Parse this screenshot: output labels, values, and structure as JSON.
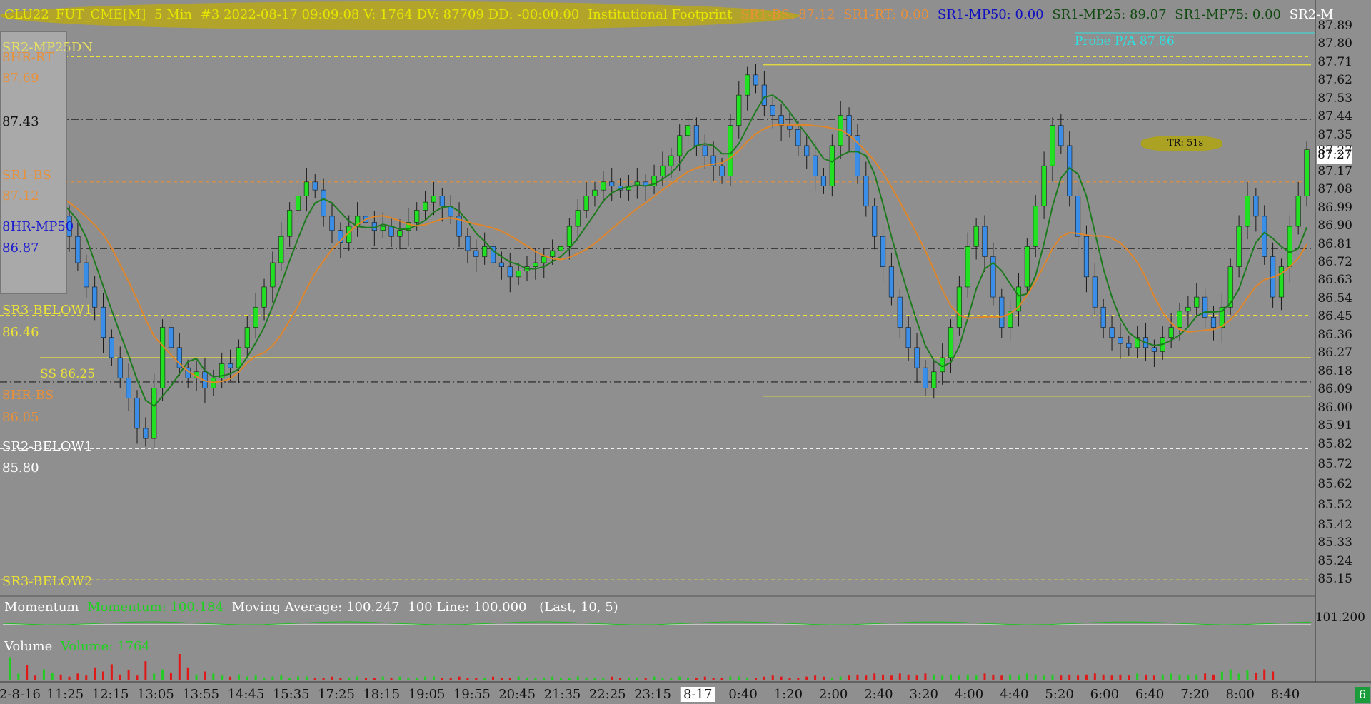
{
  "header": {
    "symbol": "CLU22_FUT_CME[M]",
    "interval": "5 Min",
    "bar_info": "#3 2022-08-17 09:09:08 V: 1764 DV: 87709 DD: -00:00:00",
    "study": "Institutional Footprint",
    "sr1_bs": "SR1-BS: 87.12",
    "sr1_rt": "SR1-RT: 0.00",
    "sr1_mp50": "SR1-MP50: 0.00",
    "sr1_mp25": "SR1-MP25: 89.07",
    "sr1_mp75": "SR1-MP75: 0.00",
    "sr2_m": "SR2-M"
  },
  "annotations": {
    "probe": "Probe P/A 87.86",
    "tr": "TR: 51s",
    "ss": "SS 86.25",
    "price_box_label": "87.43"
  },
  "levels": [
    {
      "label": "SR2-MP25DN",
      "value": "",
      "color": "#e8e060"
    },
    {
      "label": "8HR-RT",
      "value": "87.69",
      "color": "#e8903a"
    },
    {
      "label": "SR1-BS",
      "value": "87.12",
      "color": "#e8903a"
    },
    {
      "label": "8HR-MP50",
      "value": "86.87",
      "color": "#1a1ad0"
    },
    {
      "label": "SR3-BELOW1",
      "value": "86.46",
      "color": "#ece238"
    },
    {
      "label": "8HR-BS",
      "value": "86.05",
      "color": "#e8903a"
    },
    {
      "label": "SR2-BELOW1",
      "value": "85.80",
      "color": "#ffffff"
    },
    {
      "label": "SR3-BELOW2",
      "value": "",
      "color": "#ece238"
    }
  ],
  "momentum": {
    "title": "Momentum",
    "value": "Momentum: 100.184",
    "ma": "Moving Average: 100.247",
    "line": "100 Line: 100.000",
    "params": "(Last, 10, 5)",
    "axis_label": "101.200"
  },
  "volume": {
    "title": "Volume",
    "value": "Volume: 1764"
  },
  "corner_badge": "6",
  "colors": {
    "background": "#8f8f8f",
    "up_candle": "#22e022",
    "down_candle": "#3a8ee8",
    "ma_fast": "#1e7a1e",
    "ma_slow": "#e0862a",
    "header_yellow": "#e6e600",
    "volume_up": "#22cc22",
    "volume_down": "#e01818"
  },
  "chart_data": {
    "type": "candlestick",
    "y_ticks": [
      "87.89",
      "87.80",
      "87.71",
      "87.62",
      "87.53",
      "87.44",
      "87.35",
      "87.27",
      "87.17",
      "87.08",
      "86.99",
      "86.90",
      "86.81",
      "86.72",
      "86.63",
      "86.54",
      "86.45",
      "86.36",
      "86.27",
      "86.18",
      "86.09",
      "86.00",
      "85.91",
      "85.82",
      "85.72",
      "85.62",
      "85.52",
      "85.42",
      "85.33",
      "85.24",
      "85.15"
    ],
    "last_price": "87.27",
    "ylim": [
      85.08,
      87.95
    ],
    "x_ticks": [
      "2-8-16",
      "11:25",
      "12:15",
      "13:05",
      "13:55",
      "14:45",
      "15:35",
      "17:25",
      "18:15",
      "19:05",
      "19:55",
      "20:45",
      "21:35",
      "22:25",
      "23:15",
      "8-17",
      "0:40",
      "1:20",
      "2:00",
      "2:40",
      "3:20",
      "4:00",
      "4:40",
      "5:20",
      "6:00",
      "6:40",
      "7:20",
      "8:00",
      "8:40"
    ],
    "horizontal_levels": [
      {
        "price": 87.74,
        "style": "dashed",
        "color": "#ece238"
      },
      {
        "price": 87.43,
        "style": "dashdot",
        "color": "#222222"
      },
      {
        "price": 87.12,
        "style": "dashed",
        "color": "#e8903a"
      },
      {
        "price": 86.79,
        "style": "dashdot",
        "color": "#222222"
      },
      {
        "price": 86.46,
        "style": "dashed",
        "color": "#ece238"
      },
      {
        "price": 86.25,
        "style": "solid",
        "color": "#ece238"
      },
      {
        "price": 86.13,
        "style": "dashdot",
        "color": "#222222"
      },
      {
        "price": 85.8,
        "style": "dashed",
        "color": "#ffffff"
      },
      {
        "price": 85.15,
        "style": "dashed",
        "color": "#ece238"
      }
    ],
    "tr_high": 87.7,
    "tr_low": 86.06,
    "closes": [
      87.05,
      87.15,
      87.05,
      86.98,
      87.02,
      87.1,
      86.95,
      86.85,
      86.72,
      86.6,
      86.5,
      86.35,
      86.25,
      86.15,
      86.05,
      85.9,
      85.85,
      86.1,
      86.4,
      86.3,
      86.2,
      86.15,
      86.18,
      86.1,
      86.15,
      86.22,
      86.2,
      86.3,
      86.4,
      86.5,
      86.6,
      86.72,
      86.85,
      86.98,
      87.05,
      87.12,
      87.08,
      86.95,
      86.88,
      86.82,
      86.9,
      86.95,
      86.92,
      86.88,
      86.9,
      86.85,
      86.88,
      86.92,
      86.98,
      87.02,
      87.05,
      87.0,
      86.95,
      86.85,
      86.78,
      86.75,
      86.8,
      86.72,
      86.7,
      86.65,
      86.68,
      86.7,
      86.72,
      86.75,
      86.78,
      86.8,
      86.9,
      86.98,
      87.05,
      87.08,
      87.12,
      87.1,
      87.08,
      87.1,
      87.12,
      87.1,
      87.15,
      87.2,
      87.25,
      87.35,
      87.4,
      87.3,
      87.25,
      87.2,
      87.15,
      87.4,
      87.55,
      87.65,
      87.6,
      87.5,
      87.45,
      87.4,
      87.38,
      87.3,
      87.25,
      87.15,
      87.1,
      87.3,
      87.45,
      87.35,
      87.15,
      87.0,
      86.85,
      86.7,
      86.55,
      86.4,
      86.3,
      86.2,
      86.1,
      86.18,
      86.25,
      86.4,
      86.6,
      86.8,
      86.9,
      86.75,
      86.55,
      86.4,
      86.48,
      86.6,
      86.8,
      87.0,
      87.2,
      87.4,
      87.3,
      87.05,
      86.85,
      86.65,
      86.5,
      86.4,
      86.35,
      86.32,
      86.3,
      86.35,
      86.3,
      86.28,
      86.35,
      86.4,
      86.48,
      86.5,
      86.55,
      86.45,
      86.4,
      86.5,
      86.7,
      86.9,
      87.05,
      86.95,
      86.75,
      86.55,
      86.7,
      86.9,
      87.05,
      87.28
    ],
    "volume": [
      22,
      6,
      14,
      4,
      10,
      7,
      5,
      3,
      6,
      4,
      12,
      8,
      15,
      5,
      9,
      4,
      18,
      6,
      10,
      7,
      25,
      12,
      5,
      8,
      6,
      4,
      3,
      5,
      3,
      4,
      2,
      3,
      4,
      2,
      3,
      3,
      2,
      2,
      3,
      2,
      2,
      3,
      2,
      2,
      3,
      2,
      3,
      2,
      2,
      3,
      3,
      2,
      2,
      3,
      2,
      2,
      2,
      3,
      2,
      2,
      3,
      2,
      2,
      2,
      3,
      2,
      2,
      3,
      2,
      2,
      2,
      3,
      2,
      2,
      2,
      2,
      3,
      2,
      2,
      3,
      2,
      2,
      3,
      2,
      2,
      3,
      3,
      2,
      2,
      3,
      4,
      3,
      2,
      2,
      3,
      4,
      3,
      2,
      3,
      4,
      5,
      4,
      6,
      5,
      4,
      6,
      5,
      4,
      6,
      5,
      4,
      5,
      4,
      5,
      4,
      6,
      5,
      4,
      5,
      4,
      6,
      5,
      4,
      5,
      4,
      5,
      4,
      5,
      6,
      5,
      4,
      5,
      4,
      6,
      5,
      4,
      5,
      6,
      5,
      4,
      5,
      6,
      5,
      8,
      10,
      6,
      9,
      7,
      10,
      8
    ]
  }
}
